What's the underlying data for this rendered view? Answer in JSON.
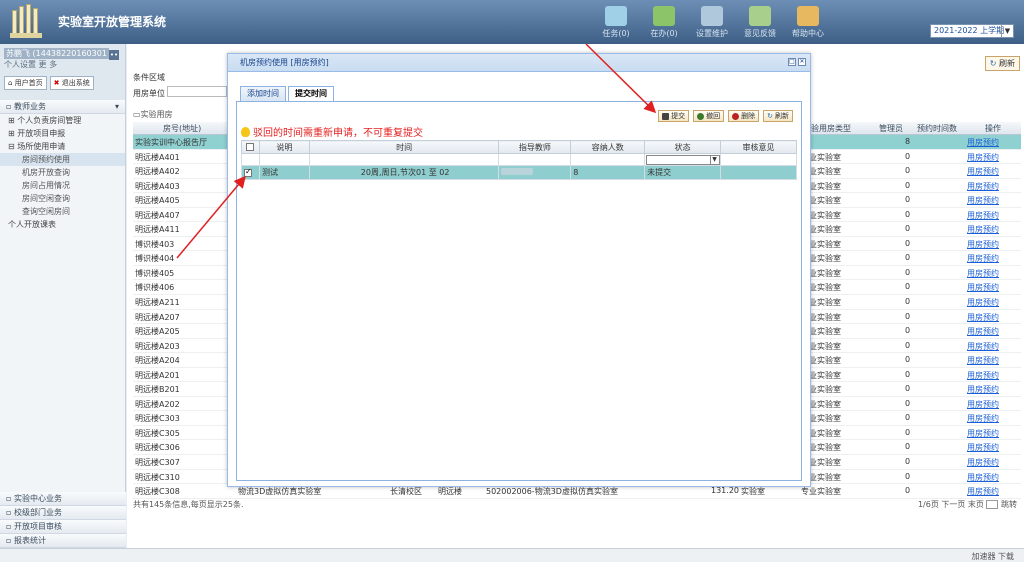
{
  "header": {
    "app_title": "实验室开放管理系统",
    "nav": [
      {
        "label": "任务(0)",
        "icon": "task-icon",
        "color": "#9fd0e8"
      },
      {
        "label": "在办(0)",
        "icon": "in-progress-icon",
        "color": "#8cc46a"
      },
      {
        "label": "设置维护",
        "icon": "settings-icon",
        "color": "#b0c8dc"
      },
      {
        "label": "意见反馈",
        "icon": "feedback-icon",
        "color": "#a8d08c"
      },
      {
        "label": "帮助中心",
        "icon": "help-icon",
        "color": "#e8b860"
      }
    ],
    "term_select": "2021-2022 上学期"
  },
  "sidebar": {
    "user_name": "苏鹏飞 (14438220160301",
    "user_info": "个人设置 更 多",
    "home_btn": "用户首页",
    "logout_btn": "退出系统",
    "section_title": "教师业务",
    "menu": [
      {
        "label": "个人负责房间管理",
        "sub": false,
        "active": false,
        "prefix": "⊞"
      },
      {
        "label": "开放项目申报",
        "sub": false,
        "active": false,
        "prefix": "⊞"
      },
      {
        "label": "场所使用申请",
        "sub": false,
        "active": false,
        "prefix": "⊟"
      },
      {
        "label": "房间预约使用",
        "sub": true,
        "active": true,
        "prefix": ""
      },
      {
        "label": "机房开放查询",
        "sub": true,
        "active": false,
        "prefix": ""
      },
      {
        "label": "房间占用情况",
        "sub": true,
        "active": false,
        "prefix": ""
      },
      {
        "label": "房间空闲查询",
        "sub": true,
        "active": false,
        "prefix": ""
      },
      {
        "label": "查询空闲房间",
        "sub": true,
        "active": false,
        "prefix": ""
      },
      {
        "label": "个人开放课表",
        "sub": false,
        "active": false,
        "prefix": ""
      }
    ],
    "bottom_sections": [
      "实验中心业务",
      "校级部门业务",
      "开放项目审核",
      "报表统计"
    ]
  },
  "main": {
    "cond_label": "条件区域",
    "unit_label": "用房单位",
    "refresh": "刷新",
    "grid_title": "实验用房",
    "columns": {
      "c0": "房号(地址)",
      "ctype": "实验用房类型",
      "admin": "管理员",
      "count": "预约时间数",
      "op": "操作"
    },
    "rows": [
      {
        "name": "实验实训中心报告厅",
        "type": "",
        "n": "8",
        "op": "用房预约",
        "sel": true
      },
      {
        "name": "明远楼A401",
        "type": "专业实验室",
        "n": "0",
        "op": "用房预约"
      },
      {
        "name": "明远楼A402",
        "type": "专业实验室",
        "n": "0",
        "op": "用房预约"
      },
      {
        "name": "明远楼A403",
        "type": "专业实验室",
        "n": "0",
        "op": "用房预约"
      },
      {
        "name": "明远楼A405",
        "type": "专业实验室",
        "n": "0",
        "op": "用房预约"
      },
      {
        "name": "明远楼A407",
        "type": "专业实验室",
        "n": "0",
        "op": "用房预约"
      },
      {
        "name": "明远楼A411",
        "type": "专业实验室",
        "n": "0",
        "op": "用房预约"
      },
      {
        "name": "博识楼403",
        "type": "专业实验室",
        "n": "0",
        "op": "用房预约"
      },
      {
        "name": "博识楼404",
        "type": "专业实验室",
        "n": "0",
        "op": "用房预约"
      },
      {
        "name": "博识楼405",
        "type": "专业实验室",
        "n": "0",
        "op": "用房预约"
      },
      {
        "name": "博识楼406",
        "type": "专业实验室",
        "n": "0",
        "op": "用房预约"
      },
      {
        "name": "明远楼A211",
        "type": "专业实验室",
        "n": "0",
        "op": "用房预约"
      },
      {
        "name": "明远楼A207",
        "type": "专业实验室",
        "n": "0",
        "op": "用房预约"
      },
      {
        "name": "明远楼A205",
        "type": "专业实验室",
        "n": "0",
        "op": "用房预约"
      },
      {
        "name": "明远楼A203",
        "type": "专业实验室",
        "n": "0",
        "op": "用房预约"
      },
      {
        "name": "明远楼A204",
        "type": "专业实验室",
        "n": "0",
        "op": "用房预约"
      },
      {
        "name": "明远楼A201",
        "type": "专业实验室",
        "n": "0",
        "op": "用房预约"
      },
      {
        "name": "明远楼B201",
        "type": "专业实验室",
        "n": "0",
        "op": "用房预约"
      },
      {
        "name": "明远楼A202",
        "type": "专业实验室",
        "n": "0",
        "op": "用房预约"
      },
      {
        "name": "明远楼C303",
        "type": "专业实验室",
        "n": "0",
        "op": "用房预约"
      },
      {
        "name": "明远楼C305",
        "type": "专业实验室",
        "n": "0",
        "op": "用房预约"
      },
      {
        "name": "明远楼C306",
        "type": "专业实验室",
        "n": "0",
        "op": "用房预约"
      },
      {
        "name": "明远楼C307",
        "type": "专业实验室",
        "n": "0",
        "op": "用房预约"
      },
      {
        "name": "明远楼C310",
        "type": "专业实验室",
        "n": "0",
        "op": "用房预约"
      },
      {
        "name": "明远楼C308",
        "type": "专业实验室",
        "n": "0",
        "op": "用房预约",
        "room_name": "物流3D虚拟仿真实验室",
        "campus": "长清校区",
        "bldg": "明远楼",
        "code": "502002006-物流3D虚拟仿真实验室",
        "area": "131.20",
        "kind": "实验室"
      }
    ],
    "footer_info": "共有145条信息,每页显示25条.",
    "pager": "1/6页 下一页 末页",
    "jump": "跳转"
  },
  "modal": {
    "title": "机房预约使用 [用房预约]",
    "tabs": [
      {
        "label": "添加时间",
        "active": false
      },
      {
        "label": "提交时间",
        "active": true
      }
    ],
    "buttons": {
      "submit": "提交",
      "back": "撤回",
      "delete": "删除",
      "refresh": "刷新"
    },
    "warning": "驳回的时间需重新申请，不可重复提交",
    "columns": {
      "desc": "说明",
      "time": "时间",
      "teacher": "指导教师",
      "capacity": "容纳人数",
      "status": "状态",
      "review": "审核意见"
    },
    "row": {
      "desc": "测试",
      "time": "20周,周日,节次01 至 02",
      "capacity": "8",
      "status": "未提交",
      "review": ""
    }
  },
  "statusbar": {
    "text": "加速器  下载"
  }
}
